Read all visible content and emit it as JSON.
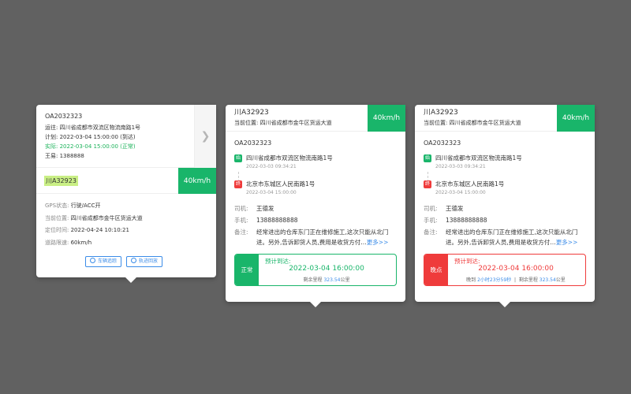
{
  "card1": {
    "order_no": "OA2032323",
    "origin_label": "运往:",
    "origin": "四川省成都市双流区物流南路1号",
    "plan_label": "计划:",
    "plan_time": "2022-03-04 15:00:00 (到达)",
    "actual_label": "实际:",
    "actual_time": "2022-03-04 15:00:00 (正常)",
    "contact": "王易:",
    "contact_phone": "1388888",
    "plate": "川A32923",
    "speed": "40km/h",
    "gps_label": "GPS状态:",
    "gps_value": "行驶/ACC开",
    "location_label": "当前位置:",
    "location_value": "四川省成都市金牛区货运大道",
    "fix_label": "定位时间:",
    "fix_value": "2022-04-24    10:10:21",
    "limit_label": "道路限速:",
    "limit_value": "60km/h",
    "btn_track": "车辆追踪",
    "btn_replay": "轨迹回放"
  },
  "card2": {
    "plate": "川A32923",
    "location_label": "当前位置:",
    "location_value": "四川省成都市金牛区货运大道",
    "speed": "40km/h",
    "order_no": "OA2032323",
    "start_badge": "始",
    "start_addr": "四川省成都市双流区物流南路1号",
    "start_time": "2022-03-03    09:34:21",
    "end_badge": "终",
    "end_addr": "北京市东城区人民南路1号",
    "end_time": "2022-03-04    15:00:00",
    "driver_label": "司机:",
    "driver": "王德发",
    "phone_label": "手机:",
    "phone": "13888888888",
    "note_label": "备注:",
    "note": "经常进出的仓库东门正在维修施工,这次只能从北门进。另外,告诉卸货人员,费用是收货方付…",
    "more": "更多>>",
    "status": "正常",
    "eta_title": "预计到达:",
    "eta_time": "2022-03-04 16:00:00",
    "remain_label": "剩余里程",
    "remain_value": "323.54",
    "remain_unit": "公里"
  },
  "card3": {
    "plate": "川A32923",
    "location_label": "当前位置:",
    "location_value": "四川省成都市金牛区货运大道",
    "speed": "40km/h",
    "order_no": "OA2032323",
    "start_badge": "始",
    "start_addr": "四川省成都市双流区物流南路1号",
    "start_time": "2022-03-03    09:34:21",
    "end_badge": "终",
    "end_addr": "北京市东城区人民南路1号",
    "end_time": "2022-03-04    15:00:00",
    "driver_label": "司机:",
    "driver": "王德发",
    "phone_label": "手机:",
    "phone": "13888888888",
    "note_label": "备注:",
    "note": "经常进出的仓库东门正在维修施工,这次只能从北门进。另外,告诉卸货人员,费用是收货方付…",
    "more": "更多>>",
    "status": "晚点",
    "eta_title": "预计到达:",
    "eta_time": "2022-03-04 16:00:00",
    "late_label": "晚到",
    "late_value": "2小时23分59秒",
    "remain_label": "剩余里程",
    "remain_value": "323.54",
    "remain_unit": "公里"
  },
  "colors": {
    "green": "#19b56a",
    "red": "#ef3b3b",
    "blue": "#3b8ce8",
    "highlight": "#c9ef85",
    "backdrop": "#616161"
  }
}
